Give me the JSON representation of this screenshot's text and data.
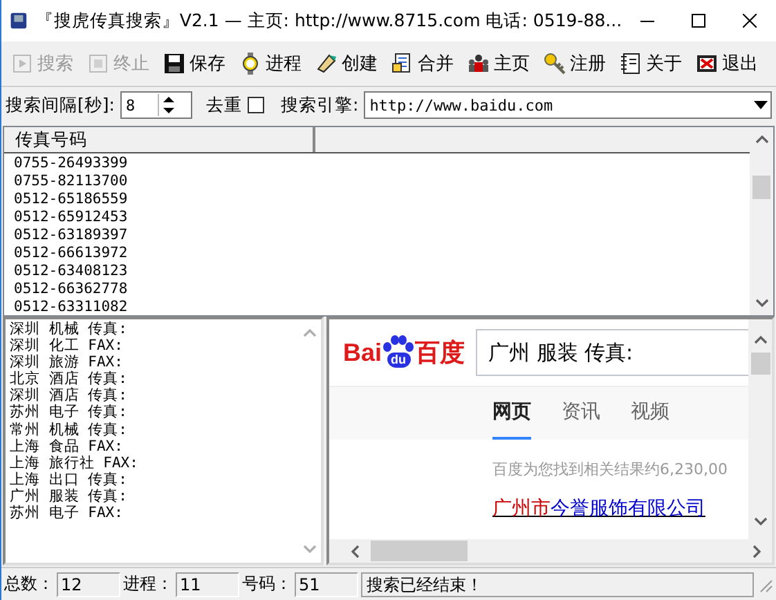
{
  "window": {
    "title": "『搜虎传真搜索』V2.1 — 主页: http://www.8715.com 电话: 0519-88..."
  },
  "toolbar": [
    {
      "label": "搜索",
      "disabled": true
    },
    {
      "label": "终止",
      "disabled": true
    },
    {
      "label": "保存",
      "disabled": false
    },
    {
      "label": "进程",
      "disabled": false
    },
    {
      "label": "创建",
      "disabled": false
    },
    {
      "label": "合并",
      "disabled": false
    },
    {
      "label": "主页",
      "disabled": false
    },
    {
      "label": "注册",
      "disabled": false
    },
    {
      "label": "关于",
      "disabled": false
    },
    {
      "label": "退出",
      "disabled": false
    }
  ],
  "options": {
    "interval_label": "搜索间隔[秒]:",
    "interval_value": "8",
    "dedupe_label": "去重",
    "dedupe_checked": false,
    "engine_label": "搜索引擎:",
    "engine_value": "http://www.baidu.com"
  },
  "fax_table": {
    "columns": [
      "传真号码"
    ],
    "rows": [
      "0755-26493399",
      "0755-82113700",
      "0512-65186559",
      "0512-65912453",
      "0512-63189397",
      "0512-66613972",
      "0512-63408123",
      "0512-66362778",
      "0512-63311082"
    ]
  },
  "keywords": [
    "深圳 机械 传真:",
    "深圳 化工 FAX:",
    "深圳 旅游 FAX:",
    "北京 酒店 传真:",
    "深圳 酒店 传真:",
    "苏州 电子 传真:",
    "常州 机械 传真:",
    "上海 食品 FAX:",
    "上海 旅行社 FAX:",
    "上海 出口 传真:",
    "广州 服装 传真:",
    "苏州 电子 FAX:"
  ],
  "browser": {
    "logo": {
      "left": "Bai",
      "paw": "du",
      "right": "百度"
    },
    "query": "广州 服装 传真:",
    "tabs": [
      {
        "label": "网页",
        "selected": true
      },
      {
        "label": "资讯",
        "selected": false
      },
      {
        "label": "视频",
        "selected": false
      }
    ],
    "result_count": "百度为您找到相关结果约6,230,00",
    "result_link": {
      "highlight": "广州市",
      "rest": "今誉服饰有限公司"
    }
  },
  "status_bar": {
    "fields": [
      {
        "label": "总数：",
        "value": "12"
      },
      {
        "label": "进程：",
        "value": "11"
      },
      {
        "label": "号码：",
        "value": "51"
      }
    ],
    "message": "搜索已经结束！"
  }
}
